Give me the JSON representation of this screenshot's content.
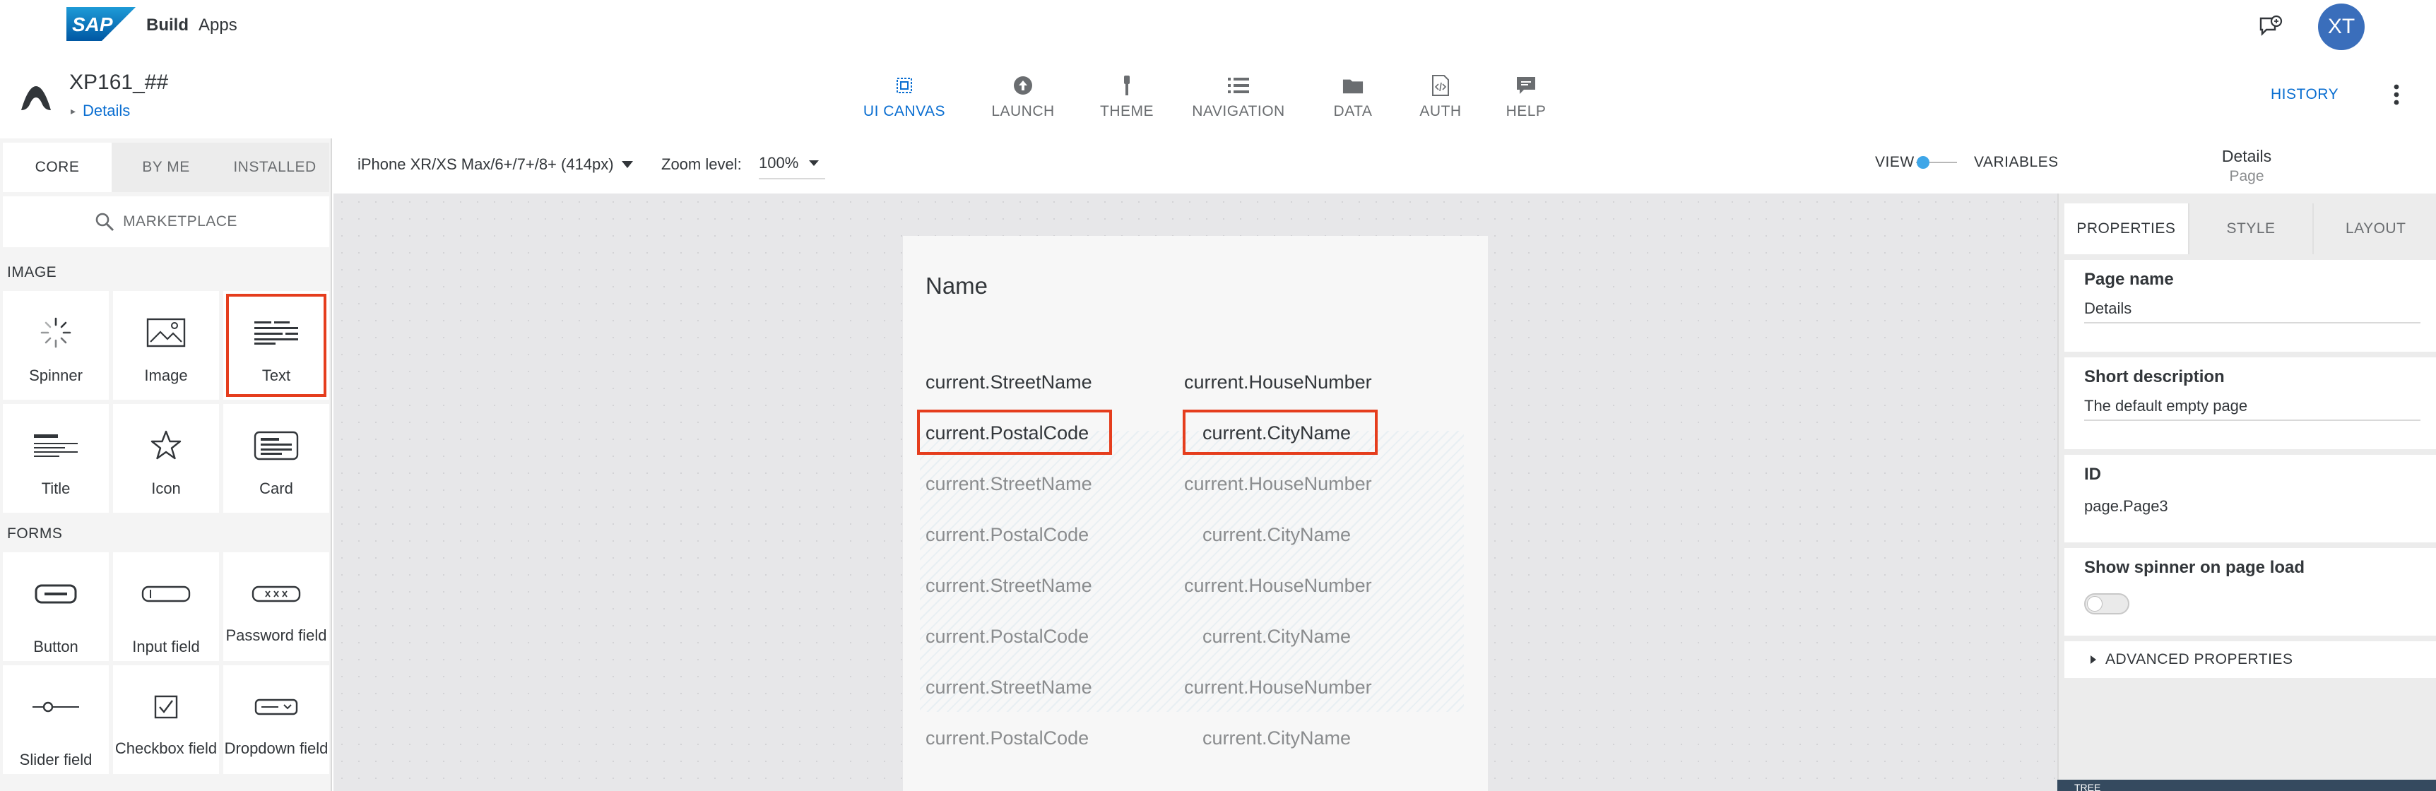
{
  "shell": {
    "brand": "SAP",
    "build": "Build",
    "apps": "Apps",
    "avatar_initials": "XT"
  },
  "header": {
    "project_title": "XP161_##",
    "breadcrumb": "Details",
    "tabs": [
      {
        "label": "UI CANVAS",
        "icon": "ui-canvas-icon",
        "active": true
      },
      {
        "label": "LAUNCH",
        "icon": "launch-icon"
      },
      {
        "label": "THEME",
        "icon": "theme-icon"
      },
      {
        "label": "NAVIGATION",
        "icon": "navigation-icon"
      },
      {
        "label": "DATA",
        "icon": "data-icon"
      },
      {
        "label": "AUTH",
        "icon": "auth-icon"
      },
      {
        "label": "HELP",
        "icon": "help-icon"
      }
    ],
    "history": "HISTORY"
  },
  "palette": {
    "tabs": [
      "CORE",
      "BY ME",
      "INSTALLED"
    ],
    "marketplace": "MARKETPLACE",
    "sections": [
      {
        "title": "IMAGE",
        "items": [
          "Spinner",
          "Image",
          "Text",
          "Title",
          "Icon",
          "Card"
        ]
      },
      {
        "title": "FORMS",
        "items": [
          "Button",
          "Input field",
          "Password field",
          "Slider field",
          "Checkbox field",
          "Dropdown field"
        ]
      }
    ],
    "selected_item": "Text"
  },
  "toolbar": {
    "device": "iPhone XR/XS Max/6+/7+/8+ (414px)",
    "zoom_label": "Zoom level:",
    "zoom_value": "100%",
    "view": "VIEW",
    "variables": "VARIABLES"
  },
  "canvas": {
    "heading": "Name",
    "rows": [
      [
        "current.StreetName",
        "current.HouseNumber"
      ],
      [
        "current.PostalCode",
        "current.CityName"
      ],
      [
        "current.StreetName",
        "current.HouseNumber"
      ],
      [
        "current.PostalCode",
        "current.CityName"
      ],
      [
        "current.StreetName",
        "current.HouseNumber"
      ],
      [
        "current.PostalCode",
        "current.CityName"
      ],
      [
        "current.StreetName",
        "current.HouseNumber"
      ],
      [
        "current.PostalCode",
        "current.CityName"
      ]
    ]
  },
  "right": {
    "title": "Details",
    "subtitle": "Page",
    "tabs": [
      "PROPERTIES",
      "STYLE",
      "LAYOUT"
    ],
    "page_name_label": "Page name",
    "page_name_value": "Details",
    "short_desc_label": "Short description",
    "short_desc_value": "The default empty page",
    "id_label": "ID",
    "id_value": "page.Page3",
    "spinner_label": "Show spinner on page load",
    "spinner_on": false,
    "advanced": "ADVANCED PROPERTIES",
    "tree": "TREE"
  }
}
